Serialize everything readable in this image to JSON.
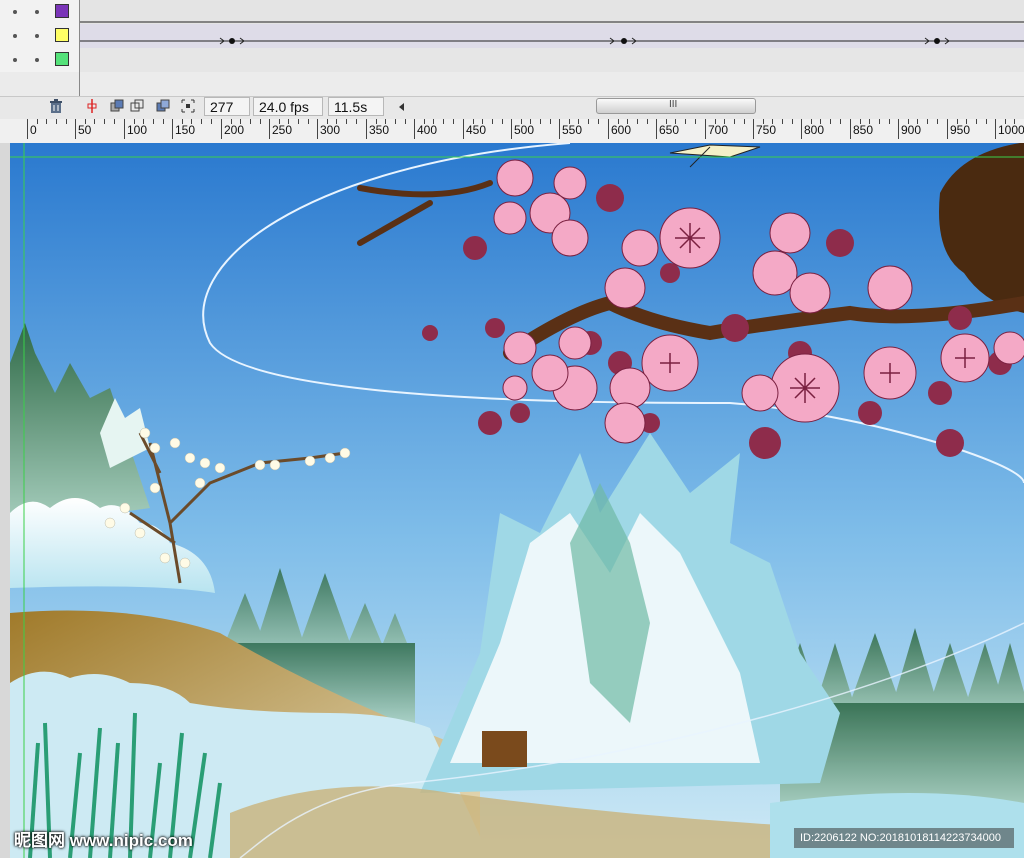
{
  "timeline": {
    "layers": [
      {
        "color": "#7a35b8"
      },
      {
        "color": "#ffff66"
      },
      {
        "color": "#55e27a"
      }
    ]
  },
  "controls": {
    "frame_number": "277",
    "fps": "24.0 fps",
    "elapsed": "11.5s",
    "scroll_grip": "III"
  },
  "ruler": {
    "ticks": [
      "0",
      "50",
      "100",
      "150",
      "200",
      "250",
      "300",
      "350",
      "400",
      "450",
      "500",
      "550",
      "600",
      "650",
      "700",
      "750",
      "800",
      "850",
      "900",
      "950",
      "1000"
    ]
  },
  "stage": {
    "sky_color": "#2a79cf",
    "blossom_color": "#f4a9c6",
    "dark_blossom_color": "#8e2c4b"
  },
  "watermark": {
    "left": "昵图网 www.nipic.com",
    "right": "ID:2206122 NO:20181018114223734000"
  }
}
